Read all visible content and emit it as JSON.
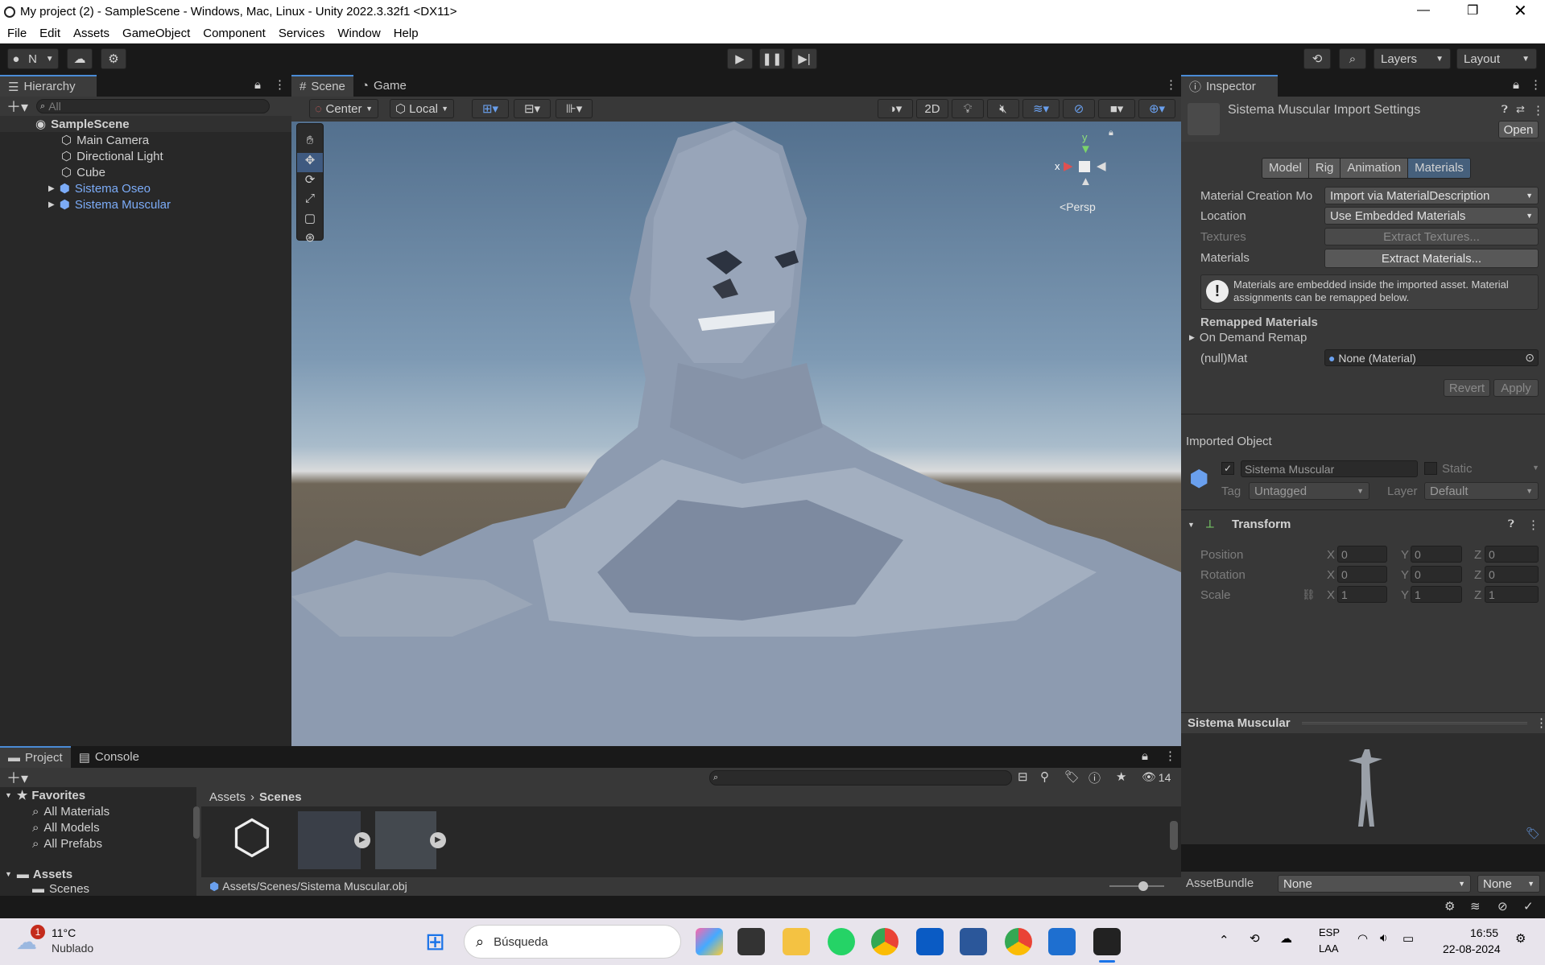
{
  "title": "My project (2) - SampleScene - Windows, Mac, Linux - Unity 2022.3.32f1 <DX11>",
  "menu": [
    "File",
    "Edit",
    "Assets",
    "GameObject",
    "Component",
    "Services",
    "Window",
    "Help"
  ],
  "toolbar": {
    "account": "N",
    "layers": "Layers",
    "layout": "Layout"
  },
  "hierarchy": {
    "tab": "Hierarchy",
    "search_placeholder": "All",
    "scene": "SampleScene",
    "items": [
      "Main Camera",
      "Directional Light",
      "Cube",
      "Sistema Oseo",
      "Sistema Muscular"
    ]
  },
  "scene": {
    "tabs": [
      "Scene",
      "Game"
    ],
    "pivot": "Center",
    "space": "Local",
    "mode2d": "2D",
    "persp": "Persp",
    "gizmo_x": "x",
    "gizmo_y": "y"
  },
  "inspector": {
    "tab": "Inspector",
    "title": "Sistema Muscular Import Settings",
    "open": "Open",
    "tabs": [
      "Model",
      "Rig",
      "Animation",
      "Materials"
    ],
    "material_creation_label": "Material Creation Mo",
    "material_creation_value": "Import via MaterialDescription",
    "location_label": "Location",
    "location_value": "Use Embedded Materials",
    "textures_label": "Textures",
    "extract_textures": "Extract Textures...",
    "materials_label": "Materials",
    "extract_materials": "Extract Materials...",
    "info": "Materials are embedded inside the imported asset. Material assignments can be remapped below.",
    "remapped": "Remapped Materials",
    "on_demand": "On Demand Remap",
    "null_mat": "(null)Mat",
    "none_material": "None (Material)",
    "revert": "Revert",
    "apply": "Apply",
    "imported_object": "Imported Object",
    "object_name": "Sistema Muscular",
    "static": "Static",
    "tag_label": "Tag",
    "tag_value": "Untagged",
    "layer_label": "Layer",
    "layer_value": "Default",
    "transform": "Transform",
    "position": "Position",
    "rotation": "Rotation",
    "scale": "Scale",
    "pos": [
      "0",
      "0",
      "0"
    ],
    "rot": [
      "0",
      "0",
      "0"
    ],
    "scl": [
      "1",
      "1",
      "1"
    ],
    "axes": [
      "X",
      "Y",
      "Z"
    ],
    "preview_title": "Sistema Muscular",
    "assetbundle": "AssetBundle",
    "ab_value": "None",
    "ab_variant": "None"
  },
  "project": {
    "tabs": [
      "Project",
      "Console"
    ],
    "favorites": "Favorites",
    "fav_items": [
      "All Materials",
      "All Models",
      "All Prefabs"
    ],
    "assets": "Assets",
    "scenes": "Scenes",
    "breadcrumb": [
      "Assets",
      "Scenes"
    ],
    "path": "Assets/Scenes/Sistema Muscular.obj",
    "count": "14"
  },
  "taskbar": {
    "temp": "11°C",
    "weather": "Nublado",
    "badge": "1",
    "search": "Búsqueda",
    "lang1": "ESP",
    "lang2": "LAA",
    "time": "16:55",
    "date": "22-08-2024"
  }
}
